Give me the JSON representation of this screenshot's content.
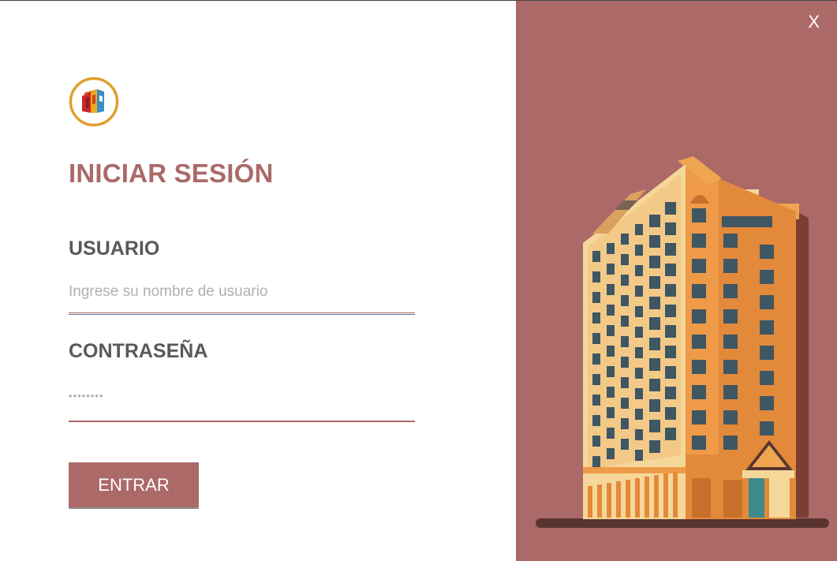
{
  "login": {
    "title": "INICIAR SESIÓN",
    "username_label": "USUARIO",
    "username_placeholder": "Ingrese su nombre de usuario",
    "password_label": "CONTRASEÑA",
    "password_value": "••••••••",
    "submit_label": "ENTRAR"
  },
  "window": {
    "close_label": "X"
  },
  "icons": {
    "logo": "building-logo-icon",
    "illustration": "hotel-building-illustration"
  },
  "colors": {
    "accent": "#ab6968",
    "label_text": "#595959",
    "placeholder_text": "#b0b0b0",
    "building_orange": "#e38a3a",
    "building_cream": "#f6d79a",
    "window_blue": "#3f5663",
    "ground": "#5a3530"
  }
}
